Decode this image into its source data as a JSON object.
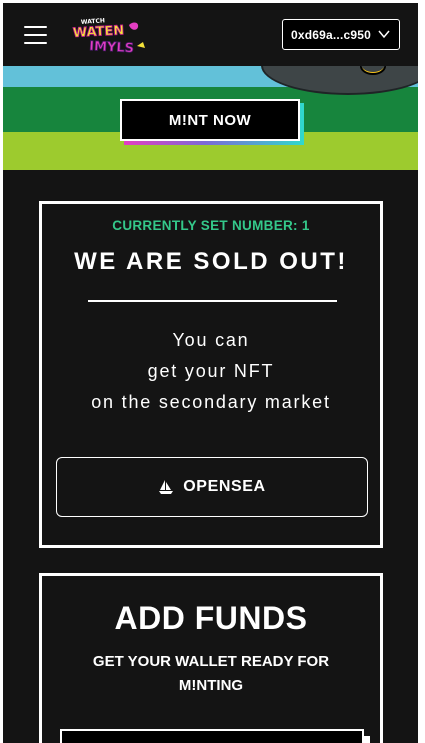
{
  "header": {
    "menu_icon": "hamburger-menu-icon",
    "logo_text": "WATCHEN IMYLS",
    "wallet_address": "0xd69a...c950",
    "wallet_chevron_icon": "chevron-down-icon"
  },
  "hero": {
    "mint_button_label": "M!NT NOW",
    "colors": {
      "sky": "#62c1d9",
      "hill": "#17853d",
      "grass": "#9dcb2e"
    }
  },
  "sold_out_card": {
    "set_number": "CURRENTLY SET NUMBER: 1",
    "title": "WE ARE SOLD OUT!",
    "message_lines": [
      "You can",
      "get your NFT",
      "on the secondary market"
    ],
    "opensea_button_label": "OPENSEA",
    "opensea_icon": "sailboat-icon"
  },
  "add_funds_card": {
    "title": "ADD FUNDS",
    "subtitle": "GET YOUR WALLET READY FOR M!NTING"
  },
  "colors": {
    "background": "#141414",
    "accent_green": "#34c88a",
    "gradient_pink": "#e33ec2",
    "gradient_teal": "#30d9cc"
  }
}
